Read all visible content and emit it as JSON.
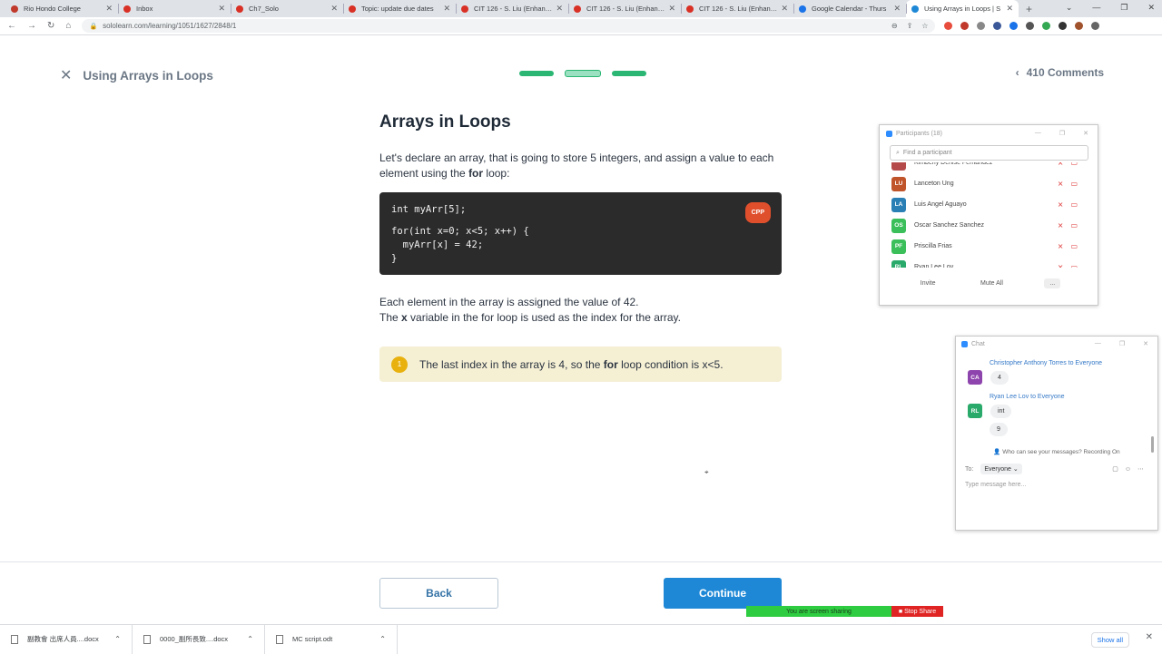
{
  "browser": {
    "tabs": [
      {
        "label": "Rio Hondo College",
        "color": "#c0392b"
      },
      {
        "label": "Inbox",
        "color": "#d93025"
      },
      {
        "label": "Ch7_Solo",
        "color": "#d93025"
      },
      {
        "label": "Topic: update due dates",
        "color": "#d93025"
      },
      {
        "label": "CIT 126 - S. Liu (Enhance",
        "color": "#d93025"
      },
      {
        "label": "CIT 126 - S. Liu (Enhance",
        "color": "#d93025"
      },
      {
        "label": "CIT 126 - S. Liu (Enhance",
        "color": "#d93025"
      },
      {
        "label": "Google Calendar - Thurs",
        "color": "#1a73e8"
      },
      {
        "label": "Using Arrays in Loops | S",
        "color": "#1e88d6"
      }
    ],
    "url": "sololearn.com/learning/1051/1627/2848/1"
  },
  "lesson": {
    "header_title": "Using Arrays in Loops",
    "comments": "410 Comments",
    "title": "Arrays in Loops",
    "intro_1": "Let's declare an array, that is going to store 5 integers, and assign a value to each element using the ",
    "intro_bold": "for",
    "intro_2": " loop:",
    "code_lines": [
      "int myArr[5];",
      "",
      "for(int x=0; x<5; x++) {",
      "  myArr[x] = 42;",
      "}"
    ],
    "code_badge": "CPP",
    "para_1": "Each element in the array is assigned the value of 42.",
    "para_2a": "The ",
    "para_2b": "x",
    "para_2c": " variable in the for loop is used as the index for the array.",
    "hint_num": "1",
    "hint_1": "The last index in the array is 4, so the ",
    "hint_bold": "for",
    "hint_2": " loop condition is x<5.",
    "back": "Back",
    "continue": "Continue"
  },
  "share_bar": {
    "status": "You are screen sharing",
    "stop": "Stop Share"
  },
  "participants": {
    "title": "Participants (18)",
    "search_placeholder": "Find a participant",
    "people": [
      {
        "initials": "",
        "name": "Kimberly Denise Fernandez",
        "color": "#b54a4a"
      },
      {
        "initials": "LU",
        "name": "Lanceton Ung",
        "color": "#c0542a"
      },
      {
        "initials": "LA",
        "name": "Luis Angel Aguayo",
        "color": "#2a7fb5"
      },
      {
        "initials": "OS",
        "name": "Oscar Sanchez Sanchez",
        "color": "#3bbf5a"
      },
      {
        "initials": "PF",
        "name": "Priscilla Frias",
        "color": "#3bbf5a"
      },
      {
        "initials": "RL",
        "name": "Ryan Lee Lov",
        "color": "#2aaa6a"
      }
    ],
    "invite": "Invite",
    "mute_all": "Mute All",
    "more": "..."
  },
  "chat": {
    "title": "Chat",
    "from_1": "Christopher Anthony Torres to Everyone",
    "initials_1": "CA",
    "color_1": "#8e44ad",
    "msg_1": "4",
    "from_2": "Ryan Lee Lov to Everyone",
    "initials_2": "RL",
    "color_2": "#2aaa6a",
    "msg_2": "int",
    "msg_3": "9",
    "info": "Who can see your messages? Recording On",
    "to_label": "To:",
    "to_value": "Everyone ⌄",
    "input_placeholder": "Type message here..."
  },
  "downloads": {
    "items": [
      "副教會 出席人員....docx",
      "0000_副所長致....docx",
      "MC script.odt"
    ],
    "show_all": "Show all"
  }
}
